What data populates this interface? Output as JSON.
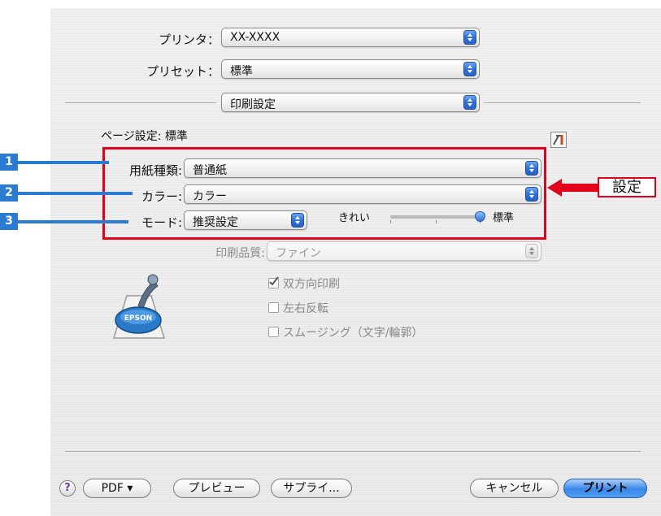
{
  "printer": {
    "label": "プリンタ：",
    "value": "XX-XXXX"
  },
  "preset": {
    "label": "プリセット：",
    "value": "標準"
  },
  "panel": {
    "value": "印刷設定"
  },
  "page_setup": {
    "label": "ページ設定: 標準"
  },
  "paper_type": {
    "label": "用紙種類:",
    "value": "普通紙"
  },
  "color": {
    "label": "カラー:",
    "value": "カラー"
  },
  "mode": {
    "label": "モード:",
    "value": "推奨設定",
    "quality_left": "きれい",
    "quality_right": "標準"
  },
  "print_quality": {
    "label": "印刷品質:",
    "value": "ファイン"
  },
  "checkboxes": [
    {
      "label": "双方向印刷",
      "checked": true
    },
    {
      "label": "左右反転",
      "checked": false
    },
    {
      "label": "スムージング（文字/輪郭）",
      "checked": false
    }
  ],
  "logo": {
    "text": "EPSON"
  },
  "annotations": {
    "numbers": [
      "1",
      "2",
      "3"
    ],
    "setting_label": "設定"
  },
  "buttons": {
    "help": "?",
    "pdf": "PDF ▾",
    "preview": "プレビュー",
    "supplies": "サプライ...",
    "cancel": "キャンセル",
    "print": "プリント"
  },
  "colors": {
    "accent_red": "#e3001b",
    "annotation_blue": "#2c7bd2",
    "mac_blue": "#3a86e8"
  }
}
